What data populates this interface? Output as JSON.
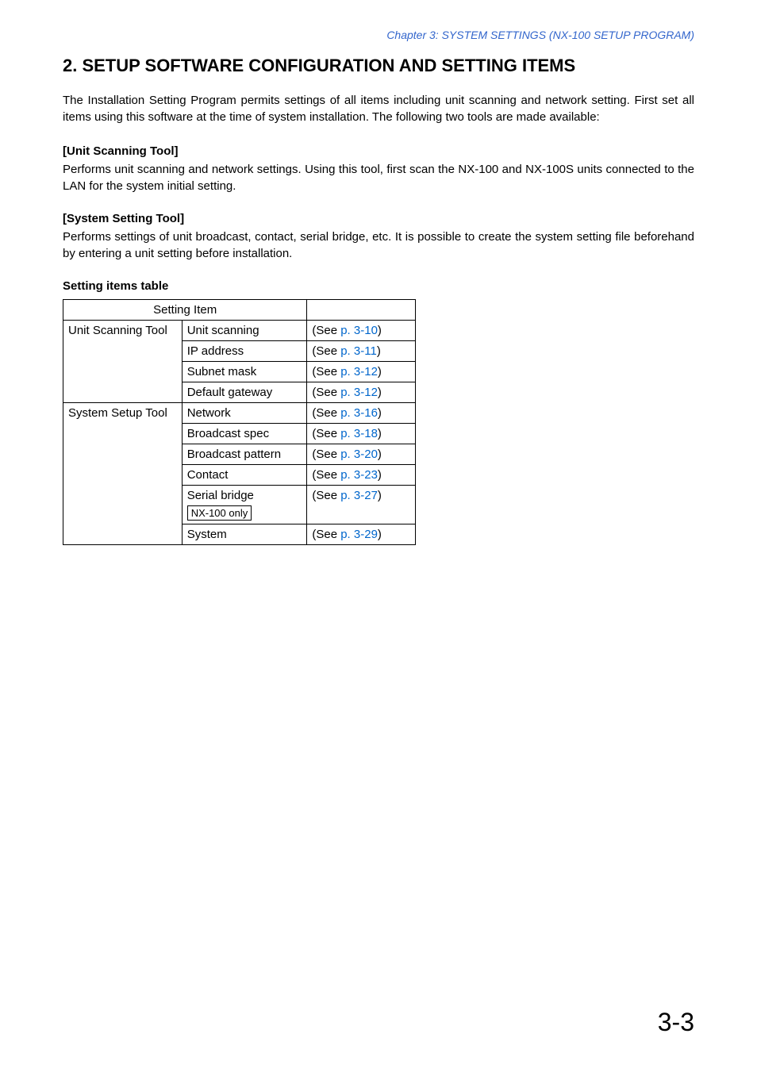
{
  "header": {
    "chapter": "Chapter 3:  SYSTEM SETTINGS (NX-100 SETUP PROGRAM)"
  },
  "title": "2. SETUP SOFTWARE CONFIGURATION AND SETTING ITEMS",
  "intro": "The Installation Setting Program permits settings of all items including unit scanning and network setting. First set all items using this software at the time of system installation. The following two tools are made available:",
  "tools": [
    {
      "heading": "[Unit Scanning Tool]",
      "desc": "Performs unit scanning and network settings. Using this tool, first scan the NX-100 and NX-100S units connected to the LAN for the system initial setting."
    },
    {
      "heading": "[System Setting Tool]",
      "desc": "Performs settings of unit broadcast, contact, serial bridge, etc. It is possible to create the system setting file beforehand by entering a unit setting before installation."
    }
  ],
  "table": {
    "title": "Setting items table",
    "header": "Setting Item",
    "see_prefix": "(See ",
    "see_suffix": ")",
    "groups": [
      {
        "group": "Unit Scanning Tool",
        "rows": [
          {
            "item": "Unit scanning",
            "page": "p. 3-10"
          },
          {
            "item": "IP address",
            "page": "p. 3-11"
          },
          {
            "item": "Subnet mask",
            "page": "p. 3-12"
          },
          {
            "item": "Default gateway",
            "page": "p. 3-12"
          }
        ]
      },
      {
        "group": "System Setup Tool",
        "rows": [
          {
            "item": "Network",
            "page": "p. 3-16"
          },
          {
            "item": "Broadcast spec",
            "page": "p. 3-18"
          },
          {
            "item": "Broadcast pattern",
            "page": "p. 3-20"
          },
          {
            "item": "Contact",
            "page": "p. 3-23"
          },
          {
            "item": "Serial bridge",
            "page": "p. 3-27",
            "note": "NX-100 only"
          },
          {
            "item": "System",
            "page": "p. 3-29"
          }
        ]
      }
    ]
  },
  "page_number": "3-3"
}
